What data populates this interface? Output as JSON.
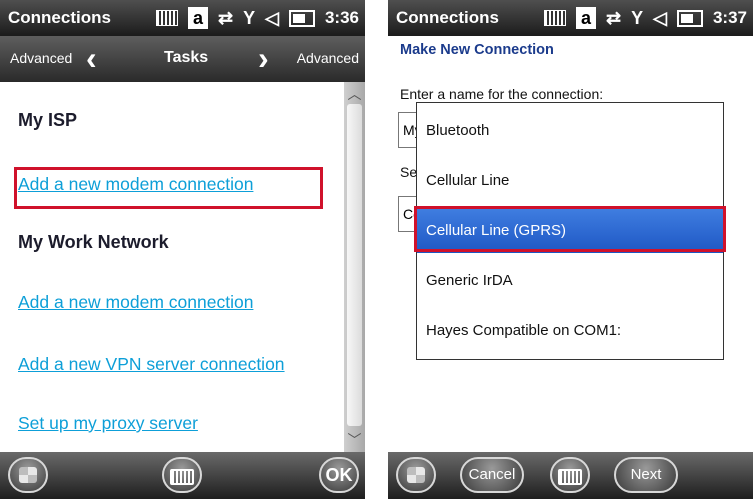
{
  "left": {
    "status": {
      "title": "Connections",
      "a_label": "a",
      "sync_glyph": "⇄",
      "signal_glyph": "Y",
      "volume_glyph": "◁",
      "battery_icon": "battery-icon",
      "time": "3:36"
    },
    "tabs": {
      "left_label": "Advanced",
      "left_arrow": "‹",
      "title": "Tasks",
      "right_arrow": "›",
      "right_label": "Advanced"
    },
    "sections": [
      {
        "heading": "My ISP",
        "links": [
          "Add a new modem connection"
        ]
      },
      {
        "heading": "My Work Network",
        "links": [
          "Add a new modem connection",
          "Add a new VPN server connection",
          "Set up my proxy server"
        ]
      }
    ],
    "bottom": {
      "ok_label": "OK"
    }
  },
  "right": {
    "status": {
      "title": "Connections",
      "a_label": "a",
      "sync_glyph": "⇄",
      "signal_glyph": "Y",
      "volume_glyph": "◁",
      "battery_icon": "battery-icon",
      "time": "3:37"
    },
    "subheader": "Make New Connection",
    "prompt": "Enter a name for the connection:",
    "background_fragments": {
      "name_value": "My",
      "select_label": "Se",
      "select_value": "Ce"
    },
    "dropdown": {
      "options": [
        "Bluetooth",
        "Cellular Line",
        "Cellular Line (GPRS)",
        "Generic IrDA",
        "Hayes Compatible on COM1:"
      ],
      "selected": "Cellular Line (GPRS)"
    },
    "bottom": {
      "cancel_label": "Cancel",
      "next_label": "Next"
    }
  },
  "colors": {
    "link": "#0d9fd8",
    "highlight": "#d0112b",
    "selection": "#1e57c4",
    "subheader": "#1b3b8c"
  }
}
